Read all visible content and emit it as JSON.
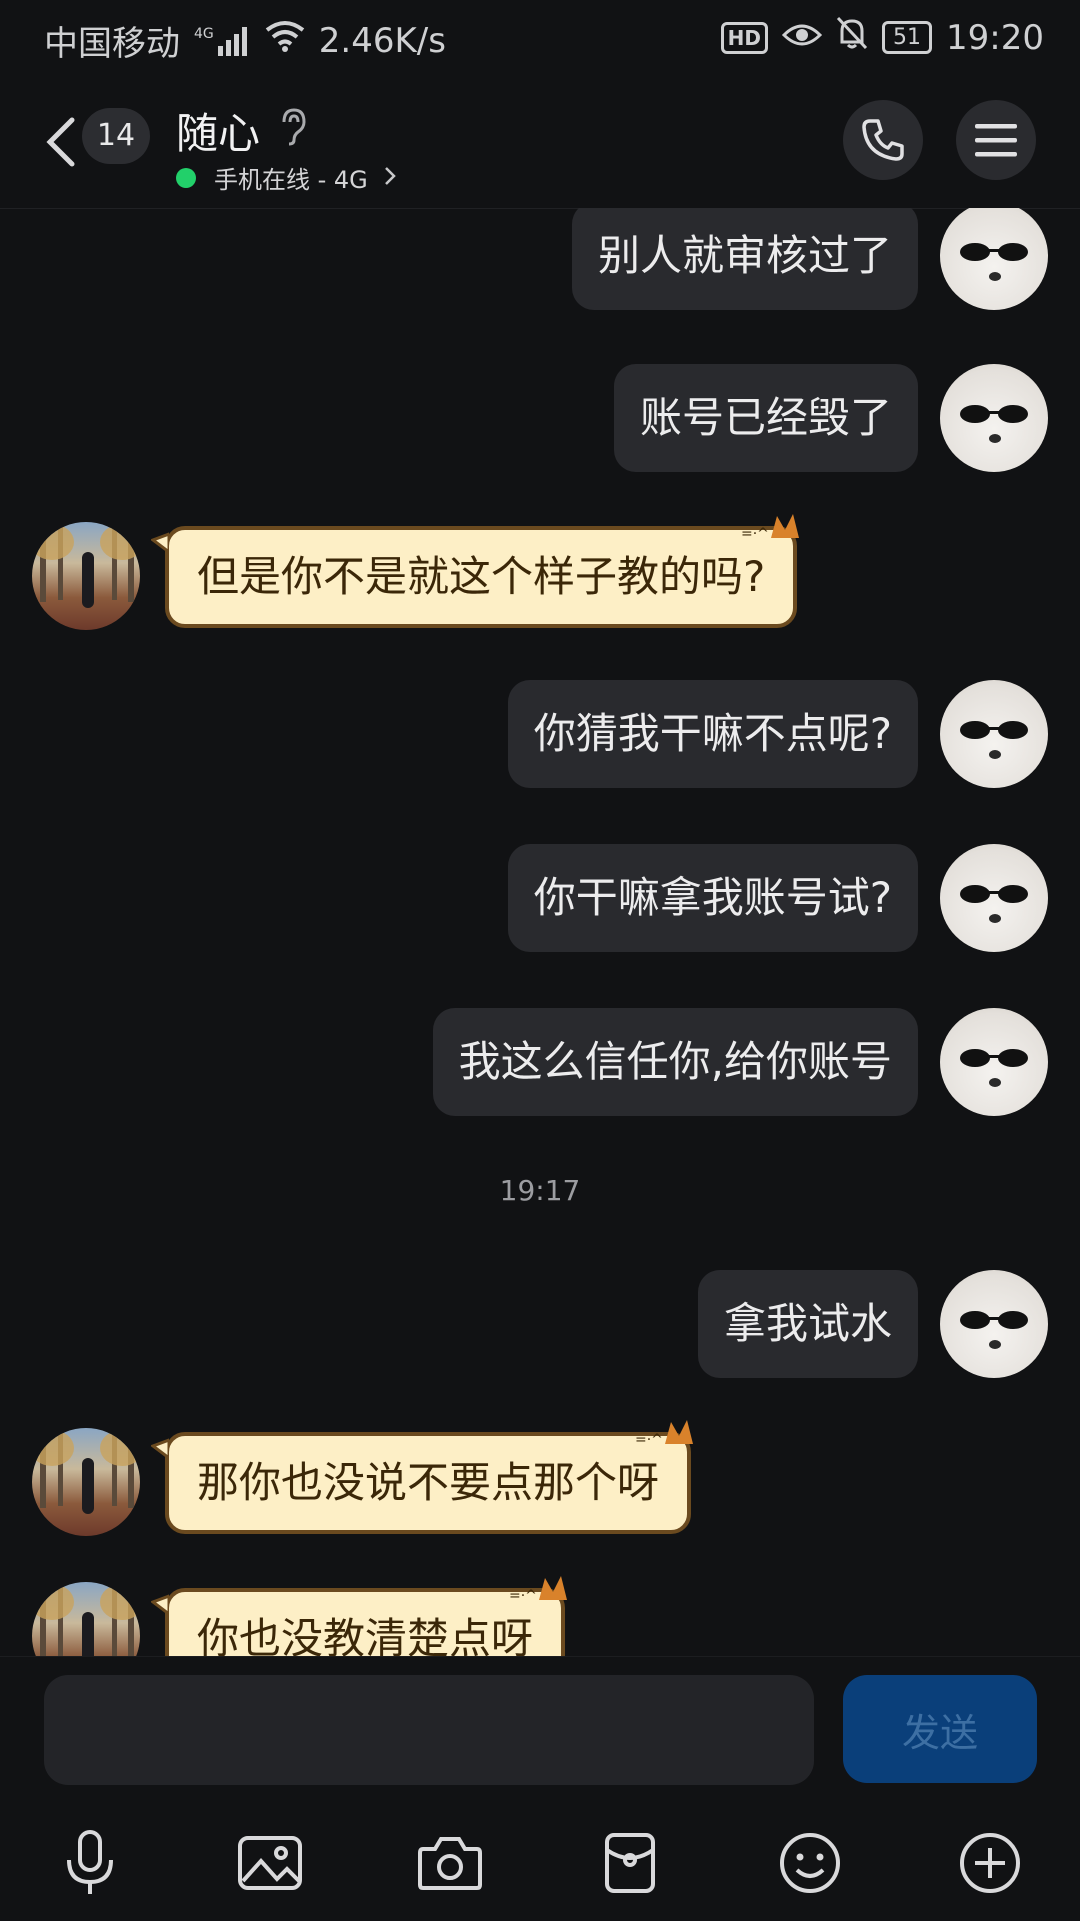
{
  "status_bar": {
    "carrier": "中国移动",
    "network": "4G",
    "speed": "2.46K/s",
    "hd": "HD",
    "battery": "51",
    "time": "19:20"
  },
  "header": {
    "unread_count": "14",
    "contact_name": "随心",
    "status_text": "手机在线 - 4G",
    "online_color": "#22d06a"
  },
  "messages": [
    {
      "side": "out",
      "text": "别人就审核过了"
    },
    {
      "side": "out",
      "text": "账号已经毁了"
    },
    {
      "side": "in",
      "text": "但是你不是就这个样子教的吗?"
    },
    {
      "side": "out",
      "text": "你猜我干嘛不点呢?"
    },
    {
      "side": "out",
      "text": "你干嘛拿我账号试?"
    },
    {
      "side": "out",
      "text": "我这么信任你,给你账号"
    },
    {
      "side": "time",
      "text": "19:17"
    },
    {
      "side": "out",
      "text": "拿我试水"
    },
    {
      "side": "in",
      "text": "那你也没说不要点那个呀"
    },
    {
      "side": "in",
      "text": "你也没教清楚点呀"
    }
  ],
  "composer": {
    "placeholder": "",
    "send_label": "发送"
  },
  "toolbar_icons": [
    "microphone-icon",
    "image-icon",
    "camera-icon",
    "red-packet-icon",
    "emoji-icon",
    "plus-icon"
  ],
  "colors": {
    "background": "#111214",
    "outgoing_bubble": "#292a2e",
    "incoming_bubble": "#fdefc6",
    "send_button": "#0a3f7a"
  }
}
